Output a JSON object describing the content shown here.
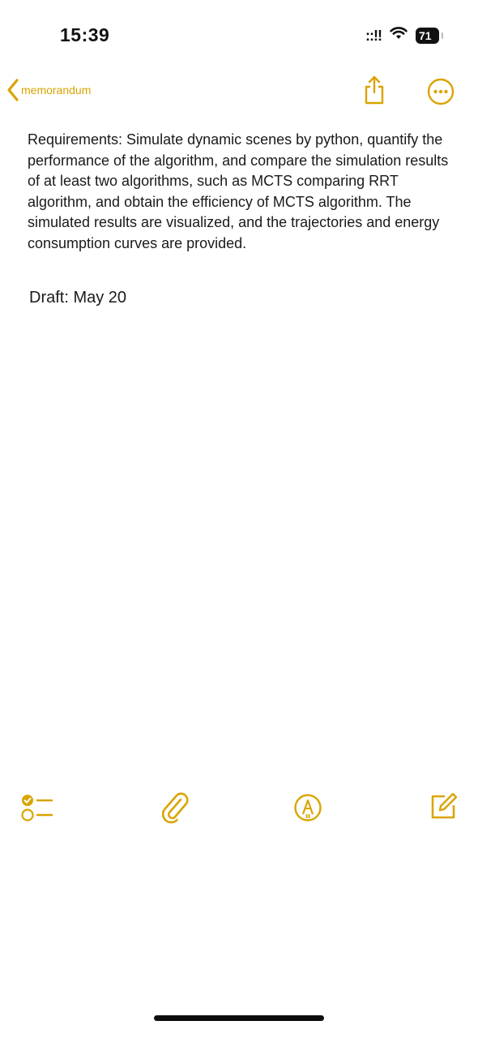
{
  "status_bar": {
    "time": "15:39",
    "signal_glyph": "::!!",
    "battery_level": "71"
  },
  "nav": {
    "back_label": "memorandum",
    "share_icon": "share-icon",
    "more_icon": "more-icon"
  },
  "note": {
    "body": "Requirements: Simulate dynamic scenes by python, quantify the performance of the algorithm, and compare the simulation results of at least two algorithms, such as MCTS comparing RRT algorithm, and obtain the efficiency of MCTS algorithm. The simulated results are visualized, and the trajectories and energy consumption curves are provided.",
    "draft": "Draft: May 20"
  },
  "toolbar": {
    "checklist_icon": "checklist-icon",
    "attachment_icon": "paperclip-icon",
    "markup_icon": "markup-pen-icon",
    "compose_icon": "compose-icon"
  },
  "colors": {
    "accent": "#d9a400",
    "text": "#1a1a1a",
    "background": "#ffffff"
  }
}
